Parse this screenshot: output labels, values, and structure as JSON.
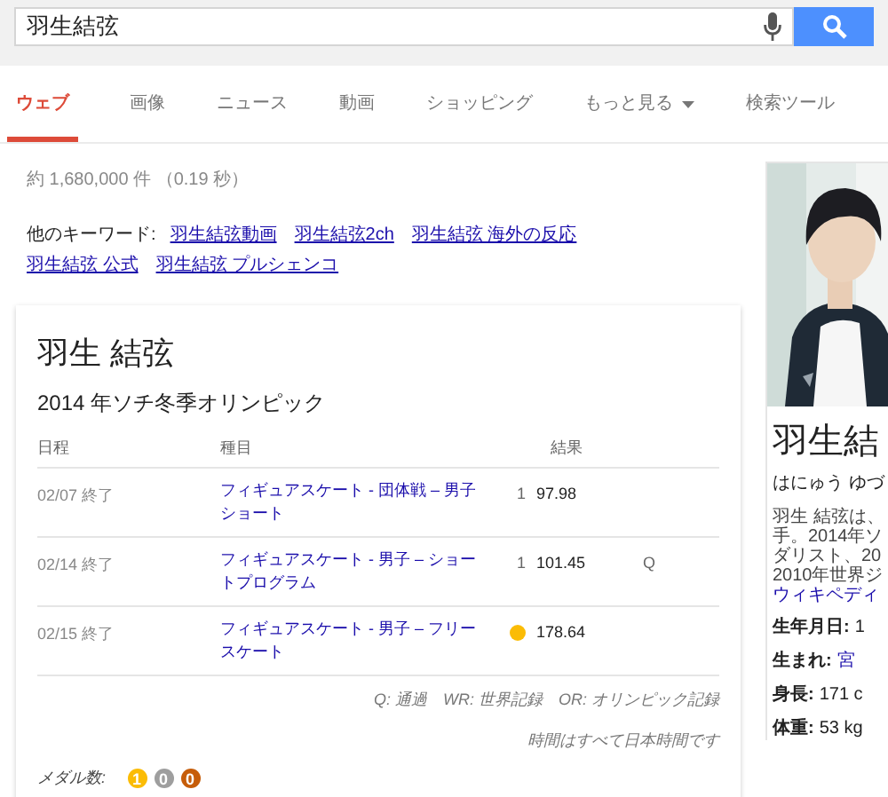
{
  "search": {
    "value": "羽生結弦"
  },
  "tabs": [
    {
      "label": "ウェブ",
      "selected": true,
      "menu": false
    },
    {
      "label": "画像",
      "selected": false,
      "menu": false
    },
    {
      "label": "ニュース",
      "selected": false,
      "menu": false
    },
    {
      "label": "動画",
      "selected": false,
      "menu": false
    },
    {
      "label": "ショッピング",
      "selected": false,
      "menu": false
    },
    {
      "label": "もっと見る",
      "selected": false,
      "menu": true
    },
    {
      "label": "検索ツール",
      "selected": false,
      "menu": false
    }
  ],
  "result_stats": "約 1,680,000 件 （0.19 秒）",
  "related": {
    "label": "他のキーワード:",
    "links": [
      "羽生結弦動画",
      "羽生結弦2ch",
      "羽生結弦 海外の反応",
      "羽生結弦 公式",
      "羽生結弦 プルシェンコ"
    ]
  },
  "card": {
    "title": "羽生 結弦",
    "subtitle": "2014 年ソチ冬季オリンピック",
    "columns": [
      "日程",
      "種目",
      "結果"
    ],
    "rows": [
      {
        "date": "02/07 終了",
        "event": "フィギュアスケート - 団体戦 – 男子ショート",
        "kind": "rank",
        "rank": "1",
        "score": "97.98"
      },
      {
        "date": "02/14 終了",
        "event": "フィギュアスケート - 男子 – ショートプログラム",
        "kind": "rank",
        "rank": "1",
        "score": "101.45",
        "note": "Q"
      },
      {
        "date": "02/15 終了",
        "event": "フィギュアスケート - 男子 – フリースケート",
        "kind": "medal",
        "color": "#fbbc05",
        "score": "178.64"
      }
    ],
    "legend": "Q: 通過　WR: 世界記録　OR: オリンピック記録",
    "timezone_note": "時間はすべて日本時間です",
    "medals": {
      "label": "メダル数:",
      "counts": [
        {
          "count": "1",
          "color": "#fbbc05"
        },
        {
          "count": "0",
          "color": "#9e9e9e"
        },
        {
          "count": "0",
          "color": "#c65d0a"
        }
      ]
    }
  },
  "panel": {
    "picture": {
      "kind": "picture"
    },
    "name": "羽生結",
    "reading": "はにゅう ゆづ",
    "description": [
      "羽生 結弦は、",
      "手。2014年ソ",
      "ダリスト、20",
      "2010年世界ジ"
    ],
    "source": "ウィキペディ",
    "facts": [
      {
        "label": "生年月日:",
        "value": "1",
        "link": false
      },
      {
        "label": "生まれ:",
        "value": "宮",
        "link": true
      },
      {
        "label": "身長:",
        "value": "171 c",
        "link": false
      },
      {
        "label": "体重:",
        "value": "53 kg",
        "link": false
      }
    ]
  }
}
